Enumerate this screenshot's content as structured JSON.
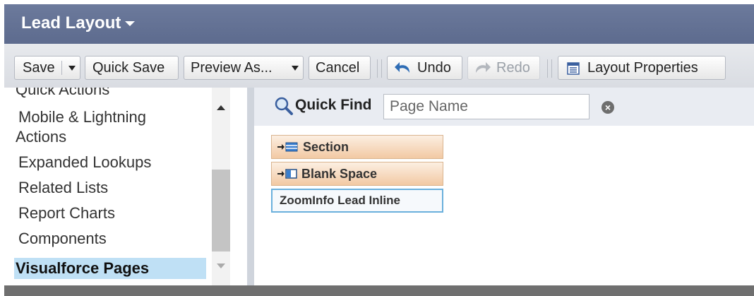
{
  "header": {
    "title": "Lead Layout"
  },
  "toolbar": {
    "save": "Save",
    "quick_save": "Quick Save",
    "preview_as": "Preview As...",
    "cancel": "Cancel",
    "undo": "Undo",
    "redo": "Redo",
    "layout_properties": "Layout Properties"
  },
  "palette_categories": {
    "items": [
      {
        "label": "Quick Actions"
      },
      {
        "label": "Mobile & Lightning"
      },
      {
        "label": "Actions"
      },
      {
        "label": "Expanded Lookups"
      },
      {
        "label": "Related Lists"
      },
      {
        "label": "Report Charts"
      },
      {
        "label": "Components"
      },
      {
        "label": "Visualforce Pages"
      }
    ],
    "selected": "Visualforce Pages"
  },
  "quick_find": {
    "label": "Quick Find",
    "placeholder": "Page Name",
    "value": ""
  },
  "palette_items": [
    {
      "label": "Section"
    },
    {
      "label": "Blank Space"
    },
    {
      "label": "ZoomInfo Lead Inline"
    }
  ],
  "colors": {
    "header_bg": "#5d6b8e",
    "selected_bg": "#bfe0f5",
    "palette_item_bg": "#f2c9a3",
    "vf_item_border": "#6ab0dc"
  },
  "icons": {
    "header_menu": "chevron-down-icon",
    "undo": "undo-arrow-icon",
    "redo": "redo-arrow-icon",
    "layout_properties": "properties-icon",
    "search": "magnifier-icon",
    "clear": "clear-x-icon",
    "section": "section-icon",
    "blank_space": "blank-space-icon"
  }
}
